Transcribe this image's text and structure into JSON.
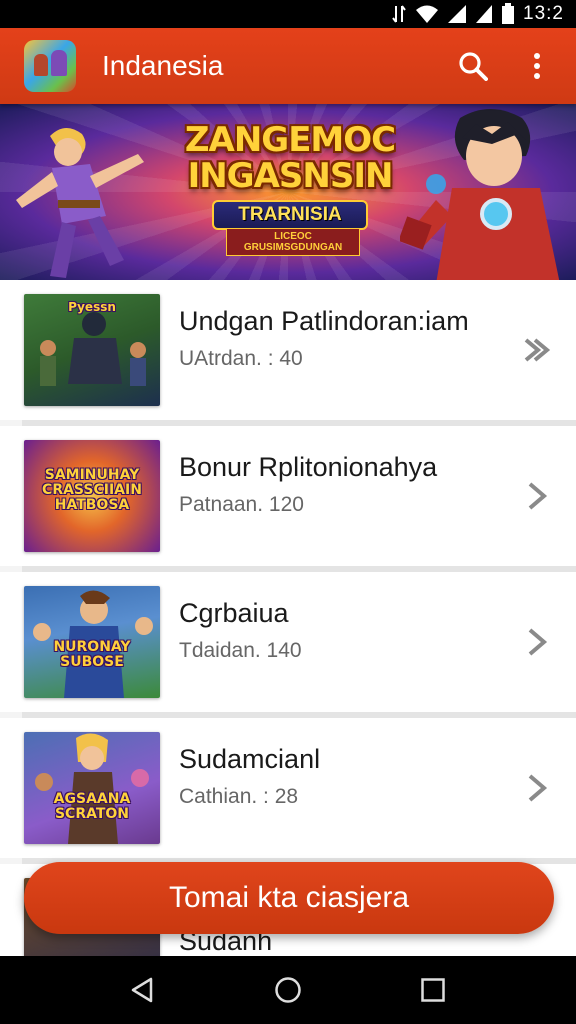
{
  "status_bar": {
    "time": "13:2"
  },
  "app_bar": {
    "title": "Indanesia",
    "icons": [
      "search-icon",
      "more-vert-icon"
    ]
  },
  "banner": {
    "title_line1": "ZANGEMOC",
    "title_line2": "INGASNSIN",
    "subtitle": "TRARNISIA",
    "tagline": "LICEOC GRUSIMSGDUNGAN"
  },
  "items": [
    {
      "title": "Undgan Patlindoran:iam",
      "subtitle": "UAtrdan. : 40",
      "thumb_text": "Pyessn",
      "thumb_colors": [
        "#3f7b3a",
        "#1d2f4e"
      ]
    },
    {
      "title": "Bonur Rplitonionahya",
      "subtitle": "Patnaan. 120",
      "thumb_text": "SAMINUHAY CRASSCIIAIN HATBOSA",
      "thumb_colors": [
        "#f0a12a",
        "#6a1f8f"
      ]
    },
    {
      "title": "Cgrbaiua",
      "subtitle": "Tdaidan. 140",
      "thumb_text": "NURONAY SUBOSE",
      "thumb_colors": [
        "#3b6fb3",
        "#3c8a3a"
      ]
    },
    {
      "title": "Sudamcianl",
      "subtitle": "Cathian. : 28",
      "thumb_text": "AGSAANA SCRATON",
      "thumb_colors": [
        "#4c6fb4",
        "#6a3a8f"
      ]
    },
    {
      "title": "Sudanh",
      "subtitle": "",
      "thumb_text": "",
      "thumb_colors": [
        "#6a4a2a",
        "#2a2a4a"
      ]
    }
  ],
  "cta": {
    "label": "Tomai kta ciasjera"
  },
  "nav_bar": {
    "icons": [
      "back-icon",
      "home-icon",
      "recents-icon"
    ]
  },
  "colors": {
    "accent": "#d83e16",
    "chevron": "#8a8a8a"
  }
}
